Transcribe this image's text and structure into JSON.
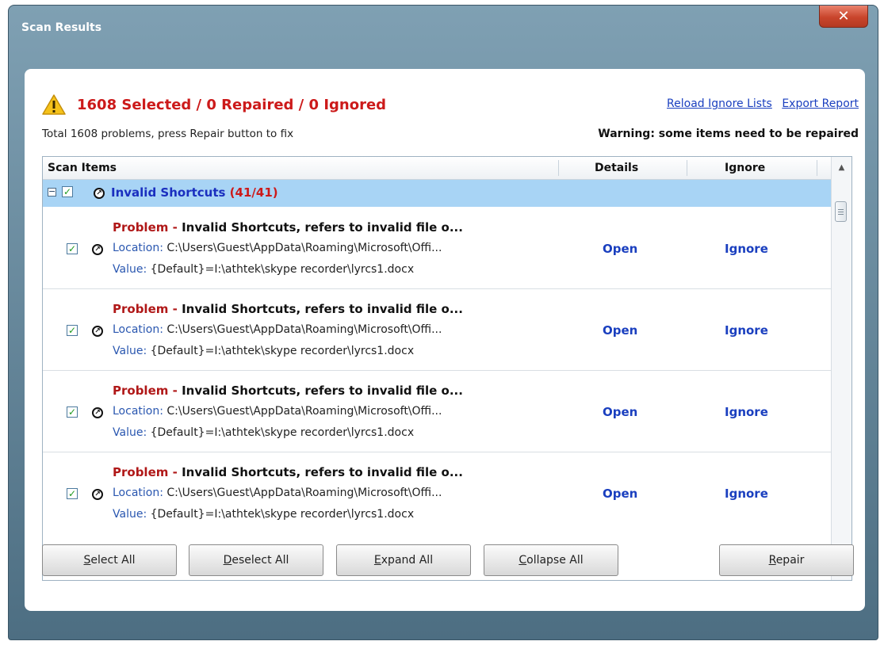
{
  "window": {
    "title": "Scan Results",
    "close_glyph": "✕"
  },
  "summary": {
    "status": "1608 Selected / 0 Repaired / 0 Ignored",
    "total": "Total 1608 problems, press Repair button to fix",
    "warning": "Warning: some items need to be repaired",
    "links": {
      "reload": "Reload Ignore Lists",
      "export": "Export Report"
    }
  },
  "table": {
    "columns": {
      "scan_items": "Scan Items",
      "details": "Details",
      "ignore": "Ignore"
    },
    "group": {
      "label": "Invalid Shortcuts",
      "count": "(41/41)",
      "expand_glyph": "−",
      "checked": true
    },
    "items": [
      {
        "problem_label": "Problem",
        "problem_sep": " - ",
        "problem_text": "Invalid Shortcuts, refers to invalid file o...",
        "location_label": "Location:",
        "location": " C:\\Users\\Guest\\AppData\\Roaming\\Microsoft\\Offi...",
        "value_label": "Value:",
        "value": " {Default}=I:\\athtek\\skype recorder\\lyrcs1.docx",
        "open": "Open",
        "ignore": "Ignore"
      },
      {
        "problem_label": "Problem",
        "problem_sep": " - ",
        "problem_text": "Invalid Shortcuts, refers to invalid file o...",
        "location_label": "Location:",
        "location": " C:\\Users\\Guest\\AppData\\Roaming\\Microsoft\\Offi...",
        "value_label": "Value:",
        "value": " {Default}=I:\\athtek\\skype recorder\\lyrcs1.docx",
        "open": "Open",
        "ignore": "Ignore"
      },
      {
        "problem_label": "Problem",
        "problem_sep": " - ",
        "problem_text": "Invalid Shortcuts, refers to invalid file o...",
        "location_label": "Location:",
        "location": " C:\\Users\\Guest\\AppData\\Roaming\\Microsoft\\Offi...",
        "value_label": "Value:",
        "value": " {Default}=I:\\athtek\\skype recorder\\lyrcs1.docx",
        "open": "Open",
        "ignore": "Ignore"
      },
      {
        "problem_label": "Problem",
        "problem_sep": " - ",
        "problem_text": "Invalid Shortcuts, refers to invalid file o...",
        "location_label": "Location:",
        "location": " C:\\Users\\Guest\\AppData\\Roaming\\Microsoft\\Offi...",
        "value_label": "Value:",
        "value": " {Default}=I:\\athtek\\skype recorder\\lyrcs1.docx",
        "open": "Open",
        "ignore": "Ignore"
      }
    ],
    "check_glyph": "✓",
    "shortcut_glyph": "↗",
    "scroll_up_glyph": "▲",
    "scroll_down_glyph": "▼"
  },
  "buttons": {
    "select_all": {
      "accel": "S",
      "rest": "elect All"
    },
    "deselect_all": {
      "accel": "D",
      "rest": "eselect All"
    },
    "expand_all": {
      "accel": "E",
      "rest": "xpand All"
    },
    "collapse_all": {
      "accel": "C",
      "rest": "ollapse All"
    },
    "repair": {
      "accel": "R",
      "rest": "epair"
    }
  },
  "icons": {
    "warning": "warning-icon",
    "close": "close-icon",
    "shortcut": "shortcut-arrow-icon",
    "checkbox": "checkbox-checked-icon"
  },
  "colors": {
    "status_red": "#cc1a1a",
    "link_blue": "#1a3fbf",
    "group_row_bg": "#a8d4f5",
    "title_bar": "#5d7f93",
    "close_red": "#c9452c"
  }
}
